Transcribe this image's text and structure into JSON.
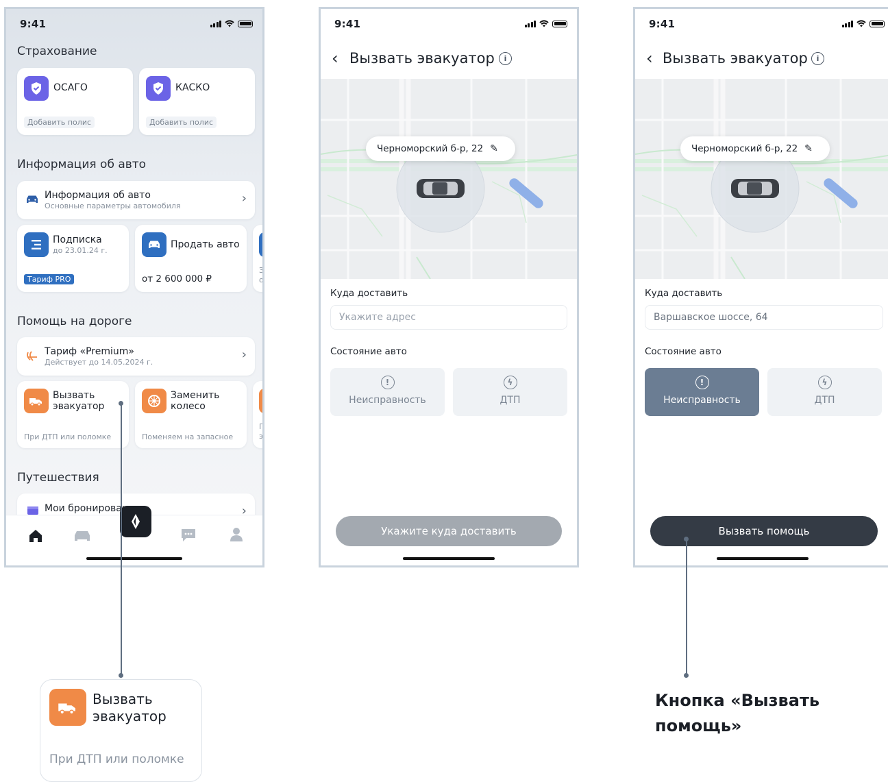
{
  "status_time": "9:41",
  "screen1": {
    "insurance": {
      "title": "Страхование",
      "cards": [
        {
          "name": "ОСАГО",
          "action": "Добавить полис"
        },
        {
          "name": "КАСКО",
          "action": "Добавить полис"
        }
      ]
    },
    "car_info": {
      "title": "Информация об авто",
      "row_title": "Информация об авто",
      "row_sub": "Основные параметры автомобиля",
      "subscription_title": "Подписка",
      "subscription_sub": "до 23.01.24 г.",
      "subscription_badge": "Тариф PRO",
      "sell_title": "Продать авто",
      "sell_price": "от 2 600 000 ₽",
      "peek_text": "З о"
    },
    "road_help": {
      "title": "Помощь на дороге",
      "tariff_title": "Тариф «Premium»",
      "tariff_sub": "Действует до 14.05.2024 г.",
      "tow_title": "Вызвать эвакуатор",
      "tow_sub": "При ДТП или поломке",
      "wheel_title": "Заменить колесо",
      "wheel_sub": "Поменяем на запасное",
      "peek_text": "П э"
    },
    "travel": {
      "title": "Путешествия",
      "booking": "Мои бронирования"
    },
    "tabbar": [
      "home-icon",
      "car-icon",
      "brand-icon",
      "chat-icon",
      "profile-icon"
    ]
  },
  "screen2": {
    "title": "Вызвать эвакуатор",
    "address_pill": "Черноморский б-р, 22",
    "deliver_label": "Куда доставить",
    "deliver_placeholder": "Укажите адрес",
    "state_label": "Состояние авто",
    "state_fault": "Неисправность",
    "state_accident": "ДТП",
    "button": "Укажите куда доставить"
  },
  "screen3": {
    "title": "Вызвать эвакуатор",
    "address_pill": "Черноморский б-р, 22",
    "deliver_label": "Куда доставить",
    "deliver_value": "Варшавское шоссе, 64",
    "state_label": "Состояние авто",
    "state_fault": "Неисправность",
    "state_accident": "ДТП",
    "button": "Вызвать помощь"
  },
  "callout_card": {
    "title": "Вызвать эвакуатор",
    "sub": "При ДТП или поломке"
  },
  "callout_text": "Кнопка «Вызвать помощь»",
  "colors": {
    "accent_purple": "#6b63e6",
    "accent_orange": "#f08a47",
    "accent_blue": "#2f6fc0",
    "dark_button": "#343b45",
    "disabled_button": "#a3a9b0",
    "selected_state": "#6b7d93"
  }
}
